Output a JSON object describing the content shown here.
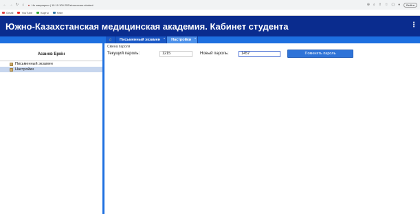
{
  "browser": {
    "url": "Не защищено | 10.10.100.252/zima-exam-student",
    "profile": "Выйти",
    "bookmarks": [
      "Gmail",
      "YouTube",
      "Карты",
      "Habr"
    ]
  },
  "app": {
    "title": "Южно-Казахстанская медицинская академия. Кабинет студента"
  },
  "sidebar": {
    "user_name": "Асанов Еркін",
    "items": [
      {
        "label": "Письменный экзамен"
      },
      {
        "label": "Настройки"
      }
    ]
  },
  "tabs": [
    {
      "label": "Письменный экзамен"
    },
    {
      "label": "Настройки"
    }
  ],
  "panel": {
    "title": "Смена пароля",
    "current_label": "Текущий пароль:",
    "current_value": "1215",
    "new_label": "Новый пароль:",
    "new_value": "1457",
    "submit_label": "Поменять пароль"
  },
  "colors": {
    "header": "#0a2c8e",
    "accent": "#1d6fe0",
    "active_tab": "#4a8fea",
    "selected_item": "#c7d6ee"
  }
}
